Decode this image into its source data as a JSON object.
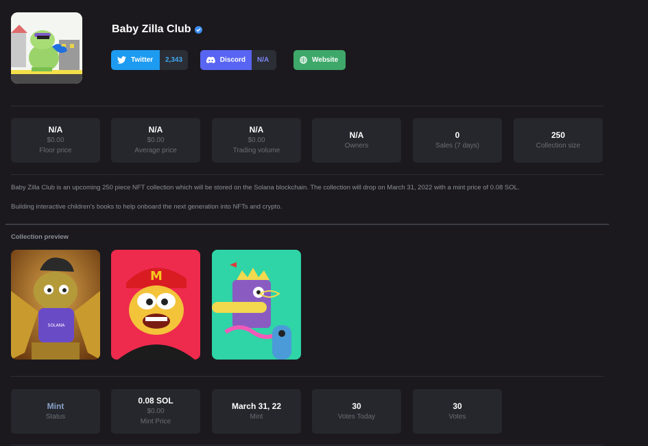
{
  "collection": {
    "name": "Baby Zilla Club"
  },
  "socials": {
    "twitter": {
      "label": "Twitter",
      "count": "2,343"
    },
    "discord": {
      "label": "Discord",
      "count": "N/A"
    },
    "website": {
      "label": "Website"
    }
  },
  "stats": [
    {
      "value": "N/A",
      "sub": "$0.00",
      "label": "Floor price"
    },
    {
      "value": "N/A",
      "sub": "$0.00",
      "label": "Average price"
    },
    {
      "value": "N/A",
      "sub": "$0.00",
      "label": "Trading volume"
    },
    {
      "value": "N/A",
      "label": "Owners"
    },
    {
      "value": "0",
      "label": "Sales (7 days)"
    },
    {
      "value": "250",
      "label": "Collection size"
    }
  ],
  "description": [
    "Baby Zilla Club is an upcoming 250 piece NFT collection which will be stored on the Solana blockchain. The collection will drop on March 31, 2022 with a mint price of 0.08 SOL.",
    "Building interactive children's books to help onboard the next generation into NFTs and crypto."
  ],
  "preview": {
    "label": "Collection preview"
  },
  "mint_stats": [
    {
      "value": "Mint",
      "label": "Status"
    },
    {
      "value": "0.08 SOL",
      "sub": "$0.00",
      "label": "Mint Price"
    },
    {
      "value": "March 31, 22",
      "label": "Mint"
    },
    {
      "value": "30",
      "label": "Votes Today"
    },
    {
      "value": "30",
      "label": "Votes"
    }
  ],
  "colors": {
    "background": "#1b191e",
    "card": "#25272c",
    "twitter": "#1d9bf0",
    "discord": "#5865f2",
    "website": "#3ea86a",
    "status_mint": "#8aa3c9"
  },
  "icons": [
    "verified-badge-icon",
    "twitter-bird-icon",
    "discord-icon",
    "globe-icon"
  ]
}
